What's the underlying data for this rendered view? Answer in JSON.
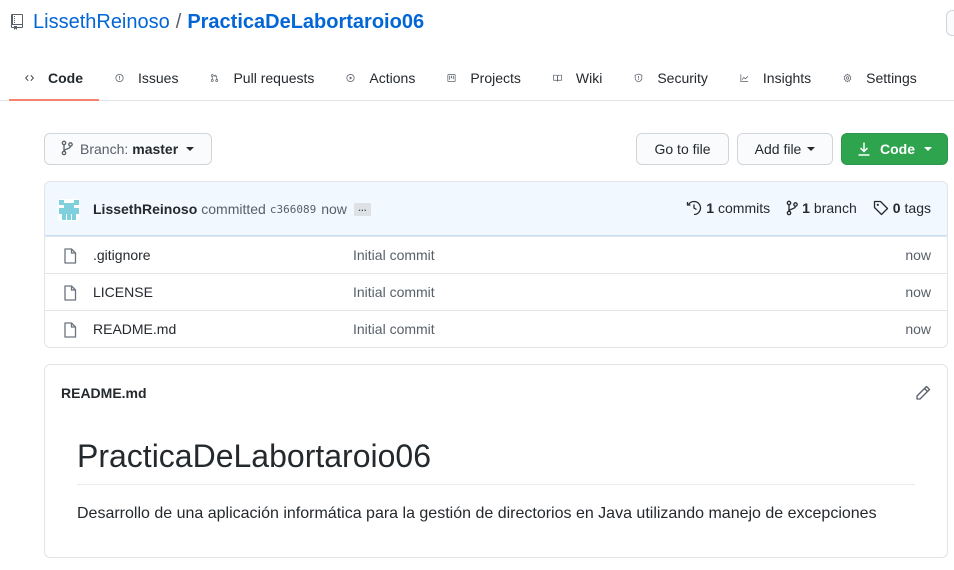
{
  "repo": {
    "owner": "LissethReinoso",
    "separator": "/",
    "name": "PracticaDeLabortaroio06"
  },
  "tabs": [
    {
      "label": "Code",
      "icon": "code-icon",
      "active": true
    },
    {
      "label": "Issues",
      "icon": "issue-icon"
    },
    {
      "label": "Pull requests",
      "icon": "pull-request-icon"
    },
    {
      "label": "Actions",
      "icon": "play-icon"
    },
    {
      "label": "Projects",
      "icon": "project-icon"
    },
    {
      "label": "Wiki",
      "icon": "book-icon"
    },
    {
      "label": "Security",
      "icon": "shield-icon"
    },
    {
      "label": "Insights",
      "icon": "graph-icon"
    },
    {
      "label": "Settings",
      "icon": "gear-icon"
    }
  ],
  "toolbar": {
    "branch_label": "Branch:",
    "branch_value": "master",
    "goto_file": "Go to file",
    "add_file": "Add file",
    "code": "Code"
  },
  "commit": {
    "author": "LissethReinoso",
    "verb": "committed",
    "sha": "c366089",
    "time": "now",
    "ellipsis": "…",
    "commits_count": "1",
    "commits_label": "commits",
    "branch_count": "1",
    "branch_label": "branch",
    "tags_count": "0",
    "tags_label": "tags"
  },
  "files": [
    {
      "name": ".gitignore",
      "message": "Initial commit",
      "age": "now"
    },
    {
      "name": "LICENSE",
      "message": "Initial commit",
      "age": "now"
    },
    {
      "name": "README.md",
      "message": "Initial commit",
      "age": "now"
    }
  ],
  "readme": {
    "filename": "README.md",
    "heading": "PracticaDeLabortaroio06",
    "paragraph": "Desarrollo de una aplicación informática para la gestión de directorios en Java utilizando manejo de excepciones"
  },
  "colors": {
    "link": "#0366d6",
    "primary_button": "#2ea44f",
    "active_tab_underline": "#f9826c",
    "commit_bar_bg": "#f1f8ff"
  }
}
